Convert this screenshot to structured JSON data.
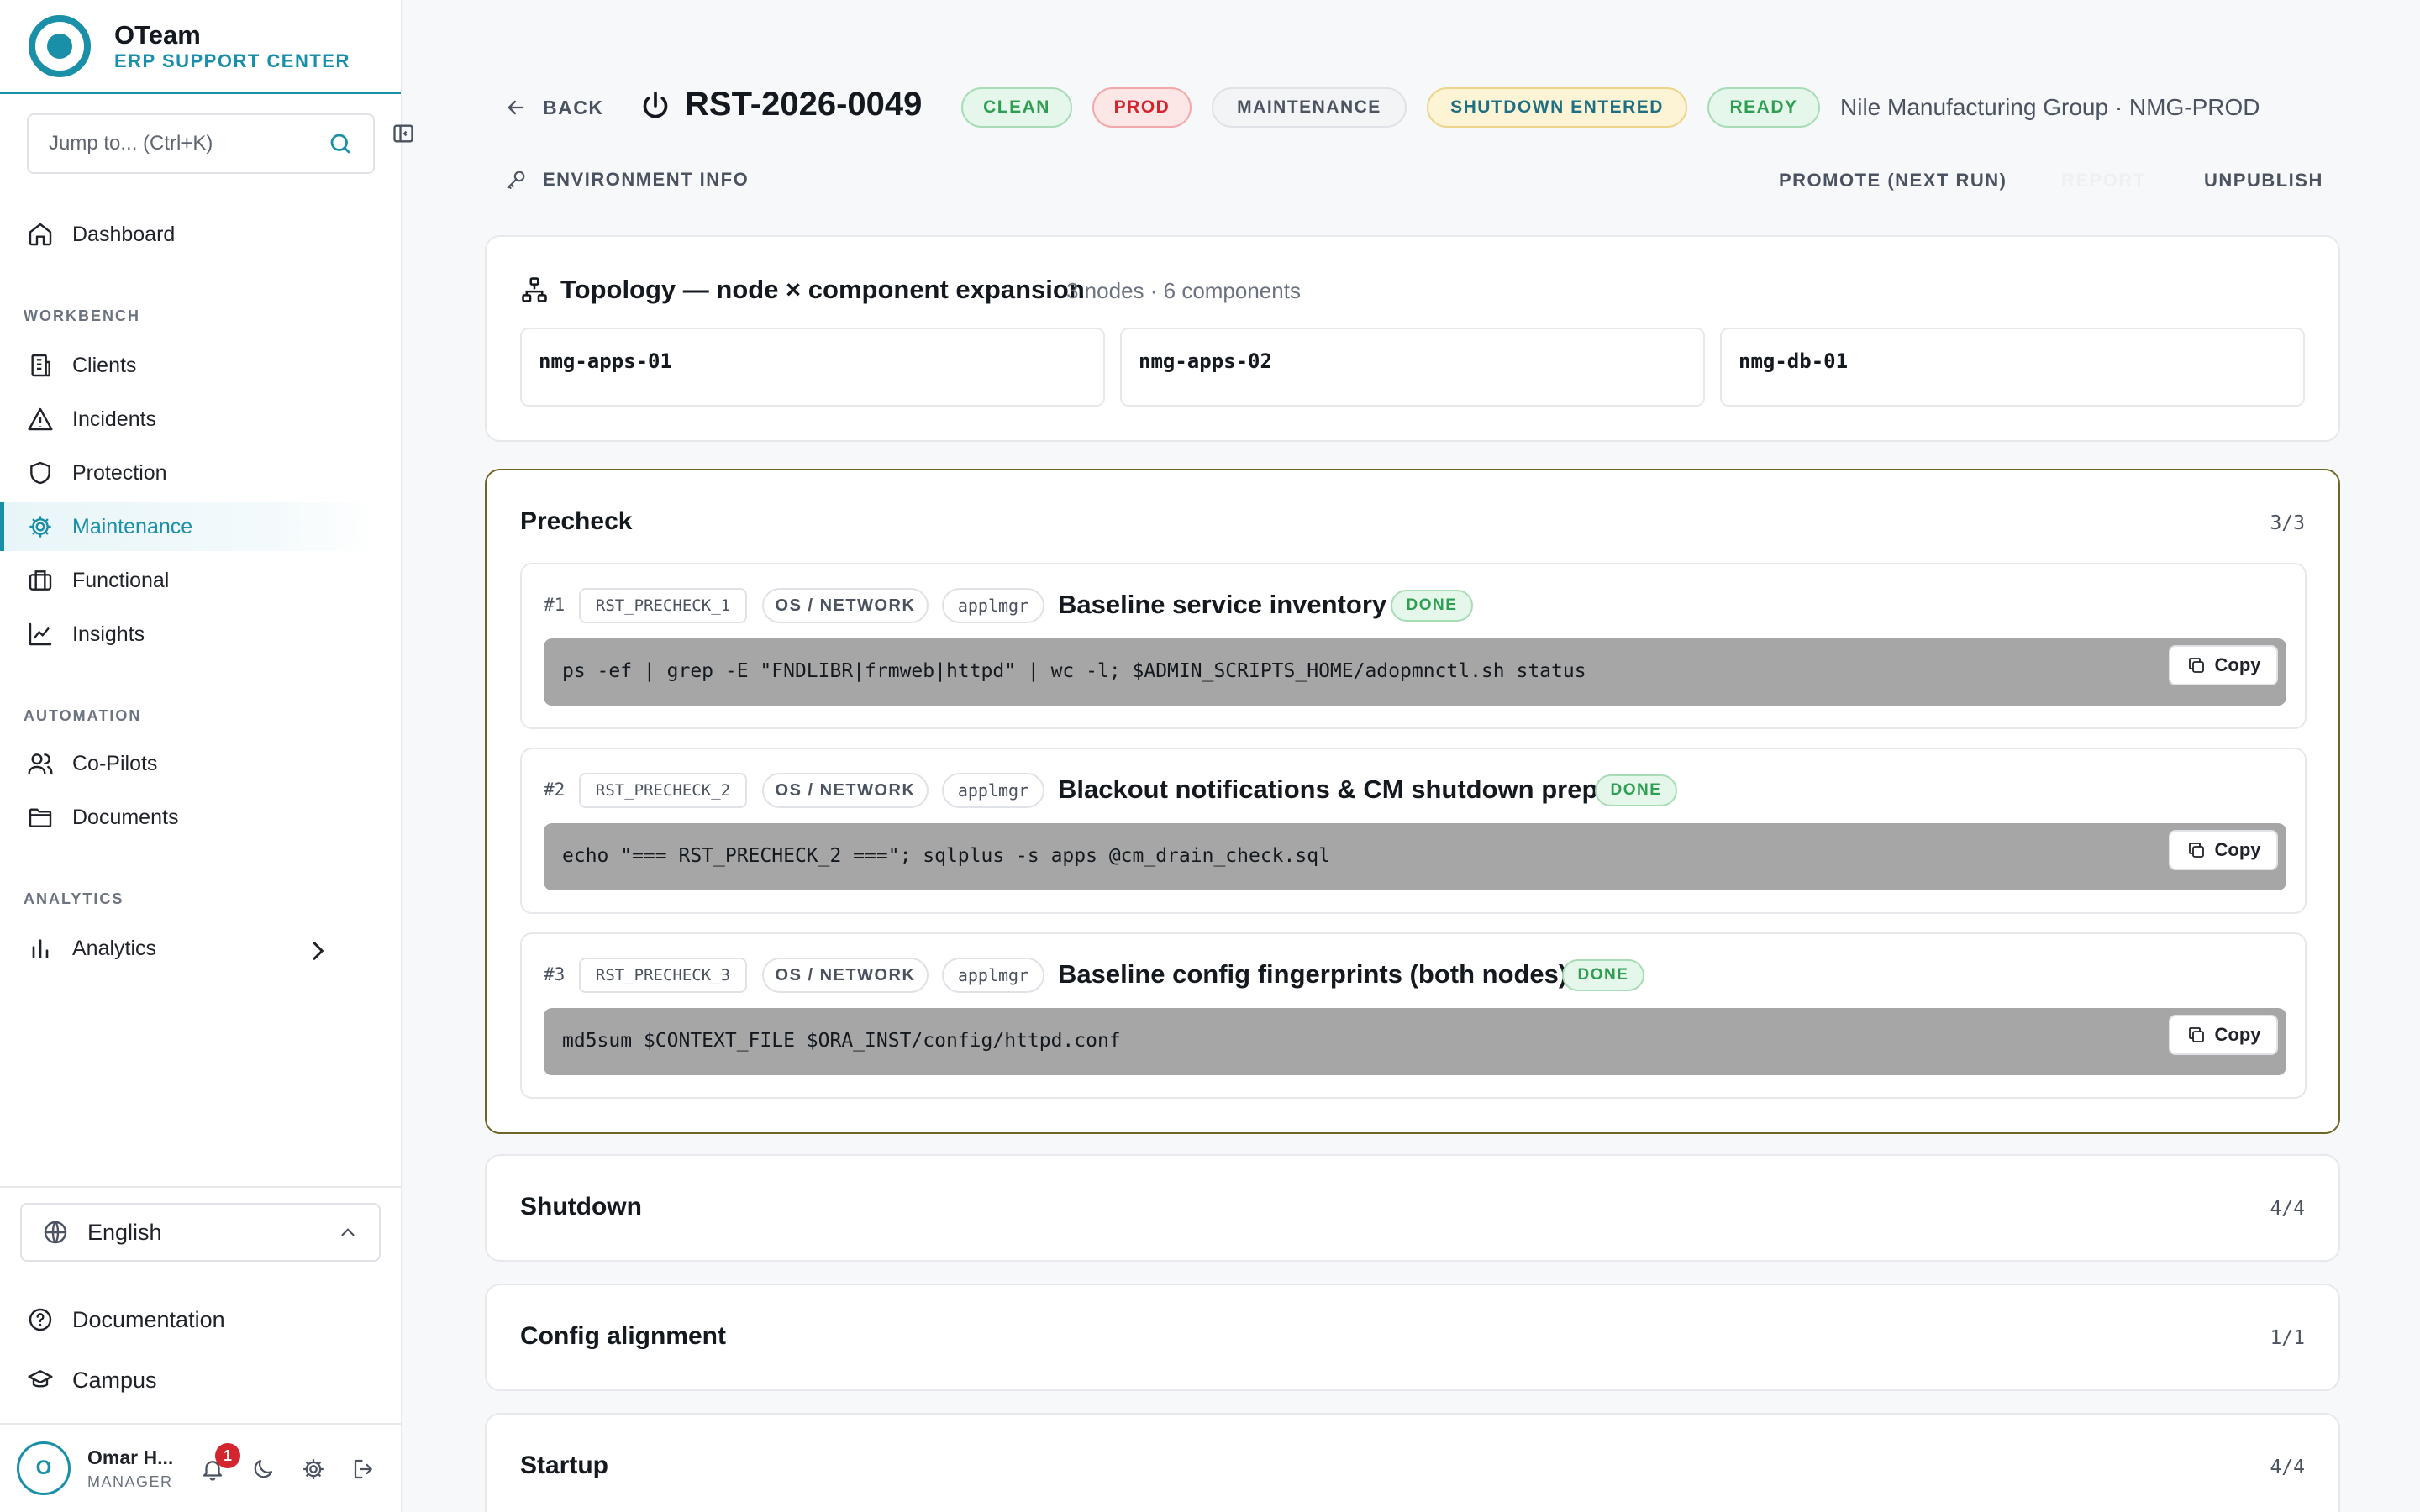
{
  "brand": {
    "title": "OTeam",
    "subtitle": "ERP SUPPORT CENTER"
  },
  "search": {
    "placeholder": "Jump to... (Ctrl+K)"
  },
  "nav": {
    "dashboard": "Dashboard",
    "workbench_label": "WORKBENCH",
    "clients": "Clients",
    "incidents": "Incidents",
    "protection": "Protection",
    "maintenance": "Maintenance",
    "functional": "Functional",
    "insights": "Insights",
    "automation_label": "AUTOMATION",
    "copilots": "Co-Pilots",
    "documents": "Documents",
    "analytics_label": "ANALYTICS",
    "analytics": "Analytics"
  },
  "language": "English",
  "footer_links": {
    "documentation": "Documentation",
    "campus": "Campus"
  },
  "user": {
    "initial": "O",
    "name": "Omar H...",
    "role": "MANAGER",
    "notifications": "1"
  },
  "header": {
    "back": "BACK",
    "title": "RST-2026-0049",
    "badges": {
      "clean": "CLEAN",
      "prod": "PROD",
      "maintenance": "MAINTENANCE",
      "shutdown": "SHUTDOWN ENTERED",
      "ready": "READY"
    },
    "client": "Nile Manufacturing Group · NMG-PROD",
    "env_info": "ENVIRONMENT INFO",
    "actions": {
      "promote": "PROMOTE (NEXT RUN)",
      "report": "REPORT",
      "unpublish": "UNPUBLISH"
    }
  },
  "topology": {
    "title": "Topology — node × component expansion",
    "count": "3 nodes · 6 components",
    "nodes": [
      "nmg-apps-01",
      "nmg-apps-02",
      "nmg-db-01"
    ]
  },
  "precheck": {
    "title": "Precheck",
    "count": "3/3",
    "steps": [
      {
        "num": "#1",
        "code": "RST_PRECHECK_1",
        "category": "OS / NETWORK",
        "user": "applmgr",
        "title": "Baseline service inventory",
        "status": "DONE",
        "command": "ps -ef | grep -E \"FNDLIBR|frmweb|httpd\" | wc -l; $ADMIN_SCRIPTS_HOME/adopmnctl.sh status"
      },
      {
        "num": "#2",
        "code": "RST_PRECHECK_2",
        "category": "OS / NETWORK",
        "user": "applmgr",
        "title": "Blackout notifications & CM shutdown prep",
        "status": "DONE",
        "command": "echo \"=== RST_PRECHECK_2 ===\"; sqlplus -s apps @cm_drain_check.sql"
      },
      {
        "num": "#3",
        "code": "RST_PRECHECK_3",
        "category": "OS / NETWORK",
        "user": "applmgr",
        "title": "Baseline config fingerprints (both nodes)",
        "status": "DONE",
        "command": "md5sum $CONTEXT_FILE $ORA_INST/config/httpd.conf"
      }
    ],
    "copy_label": "Copy"
  },
  "phases": [
    {
      "title": "Shutdown",
      "count": "4/4"
    },
    {
      "title": "Config alignment",
      "count": "1/1"
    },
    {
      "title": "Startup",
      "count": "4/4"
    }
  ],
  "colors": {
    "accent": "#1a8fa8",
    "success": "#2f9e52",
    "danger": "#d4252e",
    "warning_bg": "#fdf4d6"
  }
}
